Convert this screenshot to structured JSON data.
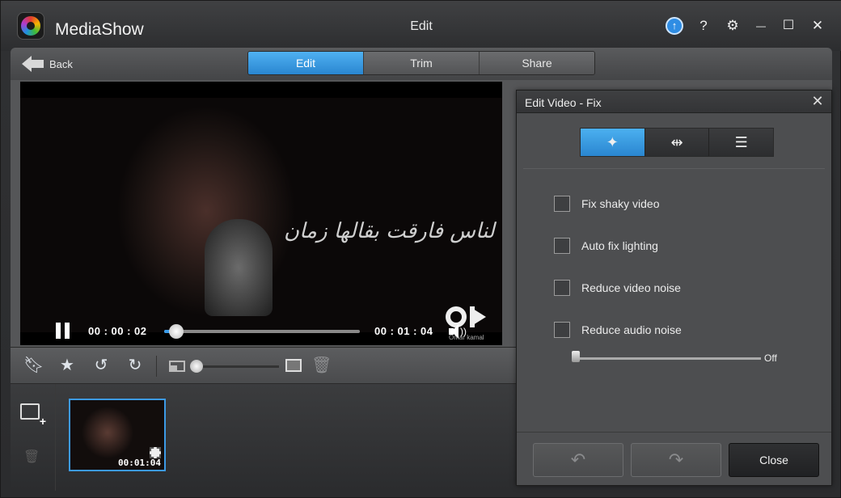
{
  "app": {
    "name": "MediaShow",
    "window_title": "Edit"
  },
  "titlebar": {
    "update_icon": "arrow-up-circle",
    "help": "?",
    "settings": "⚙",
    "minimize": "—",
    "maximize": "☐",
    "close": "✕"
  },
  "nav": {
    "back_label": "Back",
    "tabs": [
      {
        "label": "Edit",
        "active": true
      },
      {
        "label": "Trim",
        "active": false
      },
      {
        "label": "Share",
        "active": false
      }
    ]
  },
  "player": {
    "overlay_text": "لناس فارقت بقالها زمان",
    "watermark_sub": "Omar kamal",
    "current_time": "00 : 00 : 02",
    "total_time": "00 : 01 : 04",
    "progress": 0.04
  },
  "toolbar": {
    "icons": [
      "tag-icon",
      "star-icon",
      "rotate-left-icon",
      "rotate-right-icon",
      "thumbnail-small-icon",
      "thumbnail-large-icon",
      "trash-icon"
    ],
    "zoom_level": 0.0
  },
  "library": {
    "clips": [
      {
        "duration": "00:01:04"
      }
    ]
  },
  "panel": {
    "title": "Edit Video - Fix",
    "modes": [
      "magic-wand-icon",
      "split-icon",
      "checklist-icon"
    ],
    "options": [
      {
        "label": "Fix shaky video",
        "checked": false
      },
      {
        "label": "Auto fix lighting",
        "checked": false
      },
      {
        "label": "Reduce video noise",
        "checked": false
      },
      {
        "label": "Reduce audio noise",
        "checked": false
      }
    ],
    "audio_noise_value": "Off",
    "undo_label": "↶",
    "redo_label": "↷",
    "close_label": "Close"
  },
  "colors": {
    "accent": "#2f8fdb",
    "background": "#2b2c2e",
    "panel": "#4d4e50"
  }
}
